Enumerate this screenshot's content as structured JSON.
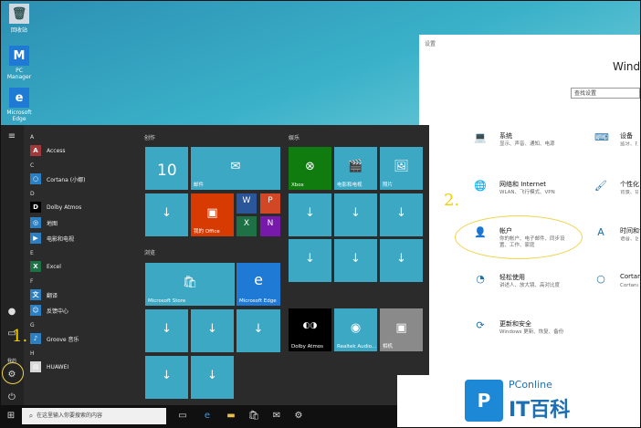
{
  "desktop": {
    "icons": [
      {
        "label": "回收站",
        "glyph": "🗑",
        "icon": "recycle-bin-icon",
        "color": "#c9d6e3"
      },
      {
        "label": "PC Manager",
        "glyph": "M",
        "icon": "pc-manager-icon",
        "color": "#1f7ad6"
      },
      {
        "label": "Microsoft Edge",
        "glyph": "e",
        "icon": "edge-icon",
        "color": "#1f7ad6"
      }
    ]
  },
  "settings": {
    "window_title": "设置",
    "heading": "Windo",
    "search_placeholder": "查找设置",
    "items": [
      {
        "title": "系统",
        "desc": "显示、声音、通知、电源",
        "icon": "laptop-icon",
        "glyph": "💻"
      },
      {
        "title": "设备",
        "desc": "蓝牙、打印机、鼠标",
        "icon": "devices-icon",
        "glyph": "⌨"
      },
      {
        "title": "网络和 Internet",
        "desc": "WLAN、飞行模式、VPN",
        "icon": "globe-icon",
        "glyph": "🌐"
      },
      {
        "title": "个性化",
        "desc": "背景、锁屏、颜色",
        "icon": "paint-icon",
        "glyph": "🖌"
      },
      {
        "title": "帐户",
        "desc": "你的帐户、电子邮件、同步设置、工作、家庭",
        "icon": "person-icon",
        "glyph": "👤"
      },
      {
        "title": "时间和语言",
        "desc": "语音、区域、日期",
        "icon": "time-language-icon",
        "glyph": "A"
      },
      {
        "title": "轻松使用",
        "desc": "讲述人、放大镜、高对比度",
        "icon": "ease-of-access-icon",
        "glyph": "◔"
      },
      {
        "title": "Cortana",
        "desc": "Cortana 语言、权限、通知",
        "icon": "cortana-icon",
        "glyph": "○"
      },
      {
        "title": "更新和安全",
        "desc": "Windows 更新、恢复、备份",
        "icon": "update-icon",
        "glyph": "⟳"
      }
    ],
    "annotation": "2."
  },
  "start_menu": {
    "apps": [
      {
        "type": "letter",
        "label": "A"
      },
      {
        "type": "app",
        "label": "Access",
        "color": "#a4373a",
        "glyph": "A"
      },
      {
        "type": "letter",
        "label": "C"
      },
      {
        "type": "app",
        "label": "Cortana (小娜)",
        "color": "#2b7fc3",
        "glyph": "○"
      },
      {
        "type": "letter",
        "label": "D"
      },
      {
        "type": "app",
        "label": "Dolby Atmos",
        "color": "#000000",
        "glyph": "D"
      },
      {
        "type": "app",
        "label": "地图",
        "color": "#2b7fc3",
        "glyph": "◎"
      },
      {
        "type": "app",
        "label": "电影和电视",
        "color": "#2b7fc3",
        "glyph": "▶"
      },
      {
        "type": "letter",
        "label": "E"
      },
      {
        "type": "app",
        "label": "Excel",
        "color": "#1e7145",
        "glyph": "X"
      },
      {
        "type": "letter",
        "label": "F"
      },
      {
        "type": "app",
        "label": "翻译",
        "color": "#2b7fc3",
        "glyph": "文"
      },
      {
        "type": "app",
        "label": "反馈中心",
        "color": "#2b7fc3",
        "glyph": "☺"
      },
      {
        "type": "letter",
        "label": "G"
      },
      {
        "type": "app",
        "label": "Groove 音乐",
        "color": "#2b7fc3",
        "glyph": "♪"
      },
      {
        "type": "letter",
        "label": "H"
      },
      {
        "type": "app",
        "label": "HUAWEI",
        "color": "#d8d8d8",
        "glyph": "▤"
      }
    ],
    "groups": [
      "创作",
      "浏览",
      "娱乐"
    ],
    "tiles": {
      "calendar_num": "10",
      "mail": "邮件",
      "office": "我的 Office",
      "xbox": "Xbox",
      "movies": "电影和电视",
      "photos": "照片",
      "store": "Microsoft Store",
      "edge": "Microsoft Edge",
      "dolby": "Dolby Atmos",
      "realtek": "Realtek Audio...",
      "camera": "相机",
      "word": "W",
      "ppt": "P",
      "excel": "X",
      "onenote": "N"
    },
    "rail_user": "我的",
    "annotation": "1."
  },
  "taskbar": {
    "search_placeholder": "在这里输入你要搜索的内容"
  },
  "logo": {
    "line1": "PConline",
    "line2": "IT百科",
    "mark": "P"
  }
}
